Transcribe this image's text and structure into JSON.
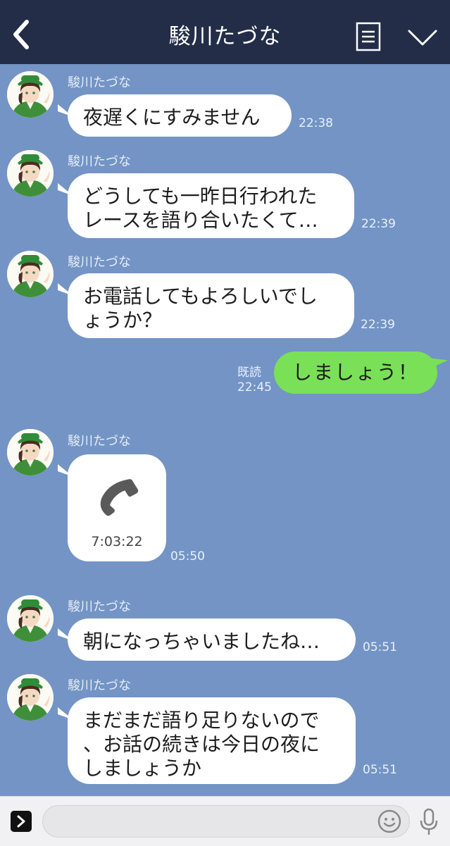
{
  "header": {
    "title": "駿川たづな"
  },
  "contact": {
    "name": "駿川たづな"
  },
  "messages": [
    {
      "text": "夜遅くにすみません",
      "time": "22:38"
    },
    {
      "text": "どうしても一昨日行われた\nレースを語り合いたくて…",
      "time": "22:39"
    },
    {
      "text": "お電話してもよろしいでし\nょうか？",
      "time": "22:39"
    },
    {
      "text": "朝になっちゃいましたね…",
      "time": "05:51"
    },
    {
      "text": "まだまだ語り足りないので\n、お話の続きは今日の夜に\nしましょうか",
      "time": "05:51"
    }
  ],
  "outgoing": {
    "text": "しましょう！",
    "read_label": "既読",
    "time": "22:45"
  },
  "call": {
    "duration": "7:03:22",
    "time": "05:50"
  },
  "colors": {
    "header_bg": "#232d48",
    "chat_bg": "#7394c5",
    "incoming_bubble": "#ffffff",
    "outgoing_bubble": "#7ae058",
    "footer_bg": "#f1f1f3"
  },
  "icons": {
    "back": "chevron-left-icon",
    "menu": "list-icon",
    "collapse": "chevron-down-icon",
    "phone": "phone-icon",
    "expand": "chevron-right-icon",
    "emoji": "smiley-icon",
    "mic": "microphone-icon"
  }
}
